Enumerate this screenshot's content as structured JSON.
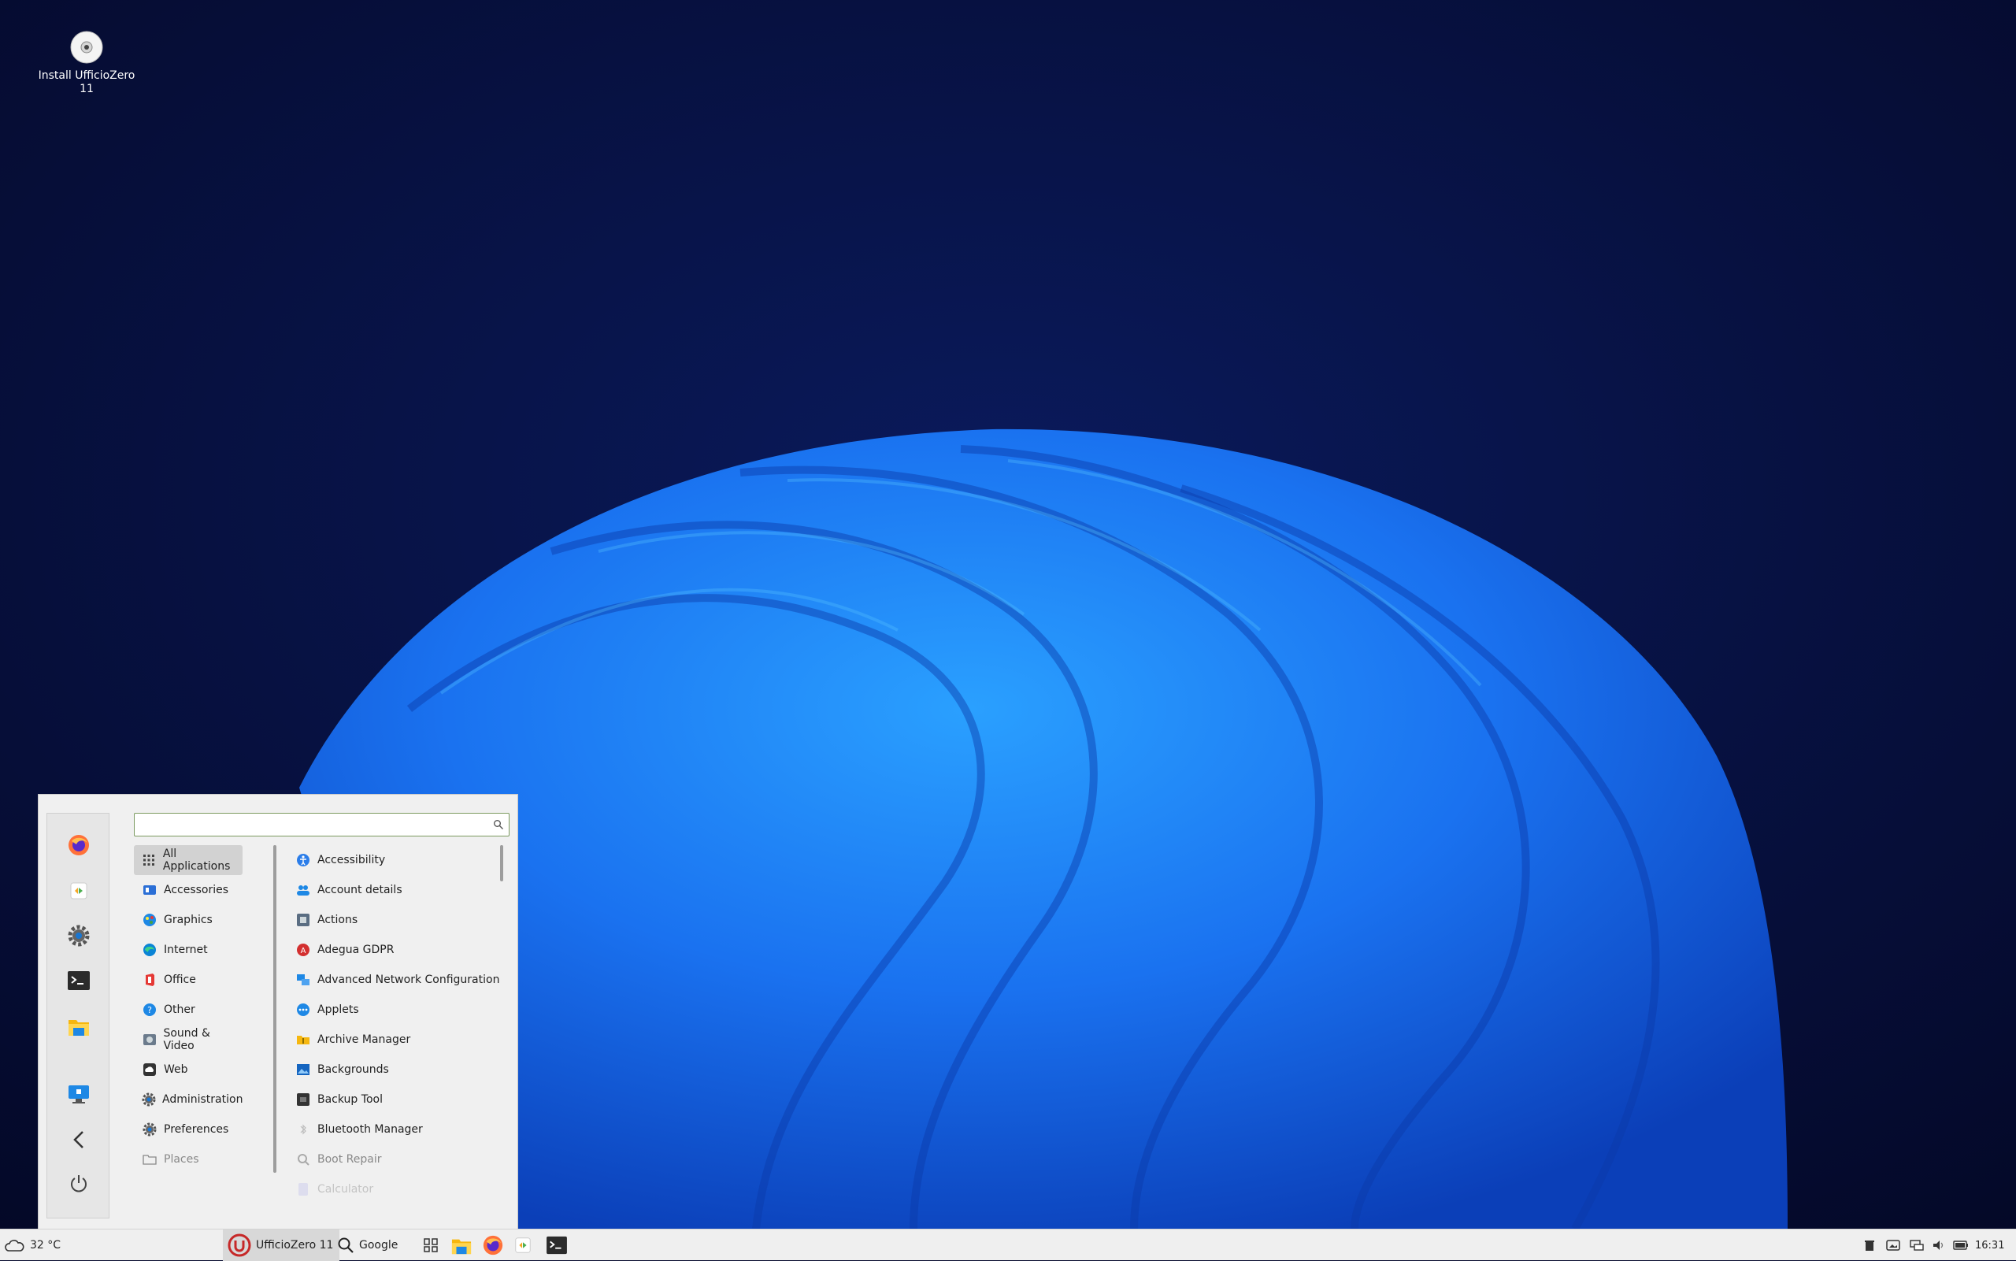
{
  "desktop": {
    "icons": [
      {
        "label": "Install UfficioZero 11",
        "icon": "disc-icon"
      }
    ]
  },
  "menu": {
    "search": {
      "value": "",
      "placeholder": ""
    },
    "favorites": [
      "firefox-icon",
      "app-installer-icon",
      "settings-gear-icon",
      "terminal-icon",
      "file-manager-icon",
      "remote-desktop-icon",
      "back-arrow-icon",
      "power-icon"
    ],
    "categories": [
      {
        "label": "All Applications",
        "icon": "grid-icon",
        "selected": true
      },
      {
        "label": "Accessories",
        "icon": "accessories-icon"
      },
      {
        "label": "Graphics",
        "icon": "graphics-icon"
      },
      {
        "label": "Internet",
        "icon": "internet-icon"
      },
      {
        "label": "Office",
        "icon": "office-icon"
      },
      {
        "label": "Other",
        "icon": "other-icon"
      },
      {
        "label": "Sound & Video",
        "icon": "sound-video-icon"
      },
      {
        "label": "Web",
        "icon": "cloud-icon"
      },
      {
        "label": "Administration",
        "icon": "admin-gear-icon"
      },
      {
        "label": "Preferences",
        "icon": "preferences-gear-icon"
      },
      {
        "label": "Places",
        "icon": "folder-icon"
      }
    ],
    "apps": [
      {
        "label": "Accessibility",
        "icon": "accessibility-icon"
      },
      {
        "label": "Account details",
        "icon": "account-icon"
      },
      {
        "label": "Actions",
        "icon": "actions-icon"
      },
      {
        "label": "Adegua GDPR",
        "icon": "gdpr-icon"
      },
      {
        "label": "Advanced Network Configuration",
        "icon": "network-icon"
      },
      {
        "label": "Applets",
        "icon": "applets-icon"
      },
      {
        "label": "Archive Manager",
        "icon": "archive-icon"
      },
      {
        "label": "Backgrounds",
        "icon": "backgrounds-icon"
      },
      {
        "label": "Backup Tool",
        "icon": "backup-icon"
      },
      {
        "label": "Bluetooth Manager",
        "icon": "bluetooth-icon"
      },
      {
        "label": "Boot Repair",
        "icon": "boot-repair-icon"
      },
      {
        "label": "Calculator",
        "icon": "calculator-icon"
      }
    ]
  },
  "taskbar": {
    "weather": "32 °C",
    "start_label": "UfficioZero 11",
    "search_label": "Google",
    "clock": "16:31",
    "pinned": [
      "workspace-switcher-icon",
      "file-manager-icon",
      "firefox-icon",
      "app-installer-icon",
      "terminal-icon"
    ],
    "tray": [
      "trash-icon",
      "display-icon",
      "network-icon",
      "volume-icon",
      "battery-icon"
    ]
  }
}
